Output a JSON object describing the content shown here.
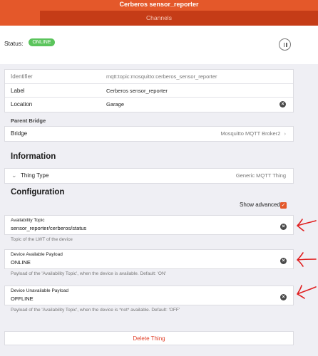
{
  "header": {
    "title": "Cerberos sensor_reporter",
    "tab_label": "Channels"
  },
  "status": {
    "label": "Status:",
    "badge": "ONLINE",
    "pause_icon": "pause-icon"
  },
  "thing_details": {
    "identifier_label": "Identifier",
    "identifier_value": "mqtt:topic:mosquitto:cerberos_sensor_reporter",
    "label_label": "Label",
    "label_value": "Cerberos sensor_reporter",
    "location_label": "Location",
    "location_value": "Garage"
  },
  "parent_bridge": {
    "group_title": "Parent Bridge",
    "bridge_label": "Bridge",
    "bridge_value": "Mosquitto MQTT Broker2",
    "chevron": "›"
  },
  "information": {
    "title": "Information",
    "thing_type_label": "Thing Type",
    "thing_type_value": "Generic MQTT Thing"
  },
  "configuration": {
    "title": "Configuration",
    "show_advanced_label": "Show advanced",
    "show_advanced_checked": true,
    "fields": [
      {
        "label": "Availability Topic",
        "value": "sensor_reporter/cerberos/status",
        "hint": "Topic of the LWT of the device"
      },
      {
        "label": "Device Available Payload",
        "value": "ONLINE",
        "hint": "Payload of the 'Availability Topic', when the device is available. Default: 'ON'"
      },
      {
        "label": "Device Unavailable Payload",
        "value": "OFFLINE",
        "hint": "Payload of the 'Availability Topic', when the device is *not* available. Default: 'OFF'"
      }
    ]
  },
  "actions": {
    "delete_label": "Delete Thing"
  },
  "colors": {
    "accent": "#e4582a",
    "tab_dark": "#c53c17",
    "online": "#5bc45c",
    "danger": "#e0402a",
    "annotation_arrow": "#e02020"
  },
  "icons": {
    "clear": "×",
    "check": "✓"
  }
}
